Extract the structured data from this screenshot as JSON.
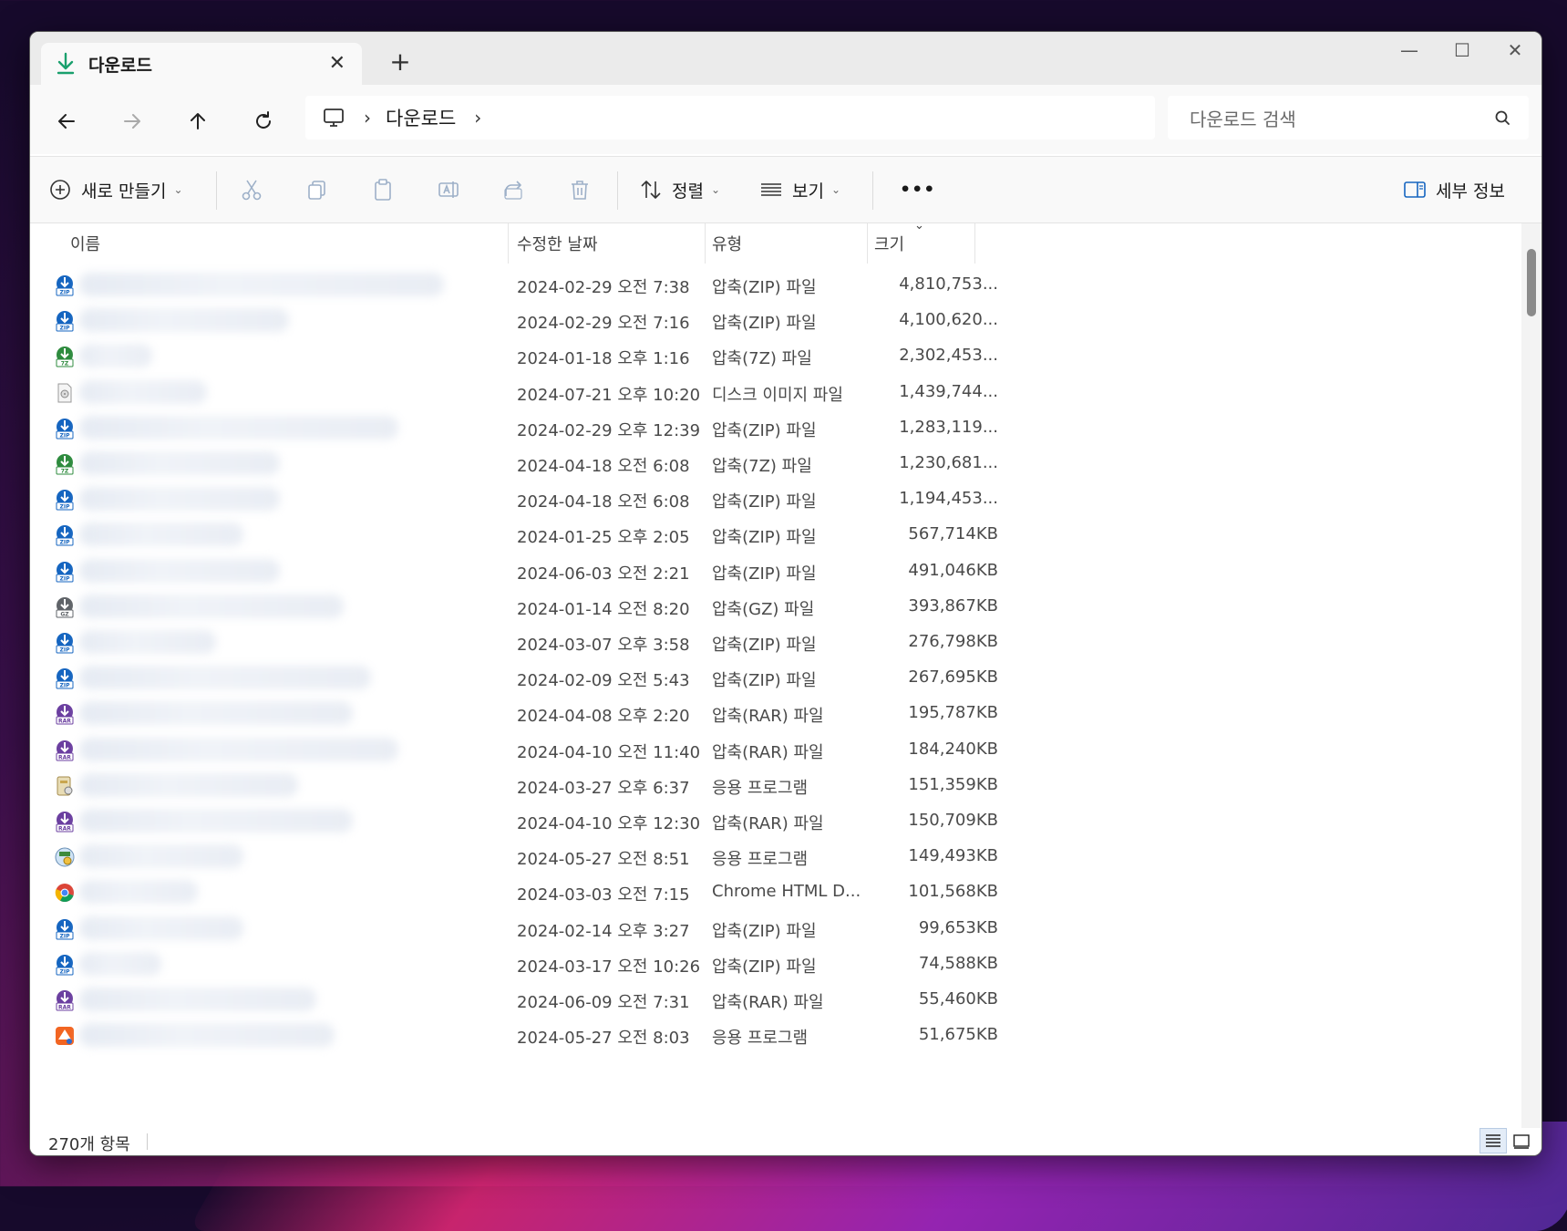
{
  "tab": {
    "title": "다운로드",
    "close": "✕",
    "new": "+"
  },
  "window_controls": {
    "minimize": "—",
    "maximize": "☐",
    "close": "✕"
  },
  "address": {
    "separator": "›",
    "crumb": "다운로드",
    "trail": "›"
  },
  "search": {
    "placeholder": "다운로드 검색"
  },
  "toolbar": {
    "new_label": "새로 만들기",
    "sort_label": "정렬",
    "view_label": "보기",
    "more_label": "•••",
    "details_label": "세부 정보",
    "chevron": "⌄"
  },
  "columns": {
    "name": "이름",
    "date": "수정한 날짜",
    "type": "유형",
    "size": "크기",
    "sort_indicator": "⌄"
  },
  "files": [
    {
      "icon": "zip-archive-icon",
      "date": "2024-02-29 오전 7:38",
      "type": "압축(ZIP) 파일",
      "size": "4,810,753..."
    },
    {
      "icon": "zip-archive-icon",
      "date": "2024-02-29 오전 7:16",
      "type": "압축(ZIP) 파일",
      "size": "4,100,620..."
    },
    {
      "icon": "7z-archive-icon",
      "date": "2024-01-18 오후 1:16",
      "type": "압축(7Z) 파일",
      "size": "2,302,453..."
    },
    {
      "icon": "disc-image-icon",
      "date": "2024-07-21 오후 10:20",
      "type": "디스크 이미지 파일",
      "size": "1,439,744..."
    },
    {
      "icon": "zip-archive-icon",
      "date": "2024-02-29 오후 12:39",
      "type": "압축(ZIP) 파일",
      "size": "1,283,119..."
    },
    {
      "icon": "7z-archive-icon",
      "date": "2024-04-18 오전 6:08",
      "type": "압축(7Z) 파일",
      "size": "1,230,681..."
    },
    {
      "icon": "zip-archive-icon",
      "date": "2024-04-18 오전 6:08",
      "type": "압축(ZIP) 파일",
      "size": "1,194,453..."
    },
    {
      "icon": "zip-archive-icon",
      "date": "2024-01-25 오후 2:05",
      "type": "압축(ZIP) 파일",
      "size": "567,714KB"
    },
    {
      "icon": "zip-archive-icon",
      "date": "2024-06-03 오전 2:21",
      "type": "압축(ZIP) 파일",
      "size": "491,046KB"
    },
    {
      "icon": "gz-archive-icon",
      "date": "2024-01-14 오전 8:20",
      "type": "압축(GZ) 파일",
      "size": "393,867KB"
    },
    {
      "icon": "zip-archive-icon",
      "date": "2024-03-07 오후 3:58",
      "type": "압축(ZIP) 파일",
      "size": "276,798KB"
    },
    {
      "icon": "zip-archive-icon",
      "date": "2024-02-09 오전 5:43",
      "type": "압축(ZIP) 파일",
      "size": "267,695KB"
    },
    {
      "icon": "rar-archive-icon",
      "date": "2024-04-08 오후 2:20",
      "type": "압축(RAR) 파일",
      "size": "195,787KB"
    },
    {
      "icon": "rar-archive-icon",
      "date": "2024-04-10 오전 11:40",
      "type": "압축(RAR) 파일",
      "size": "184,240KB"
    },
    {
      "icon": "installer-icon",
      "date": "2024-03-27 오후 6:37",
      "type": "응용 프로그램",
      "size": "151,359KB"
    },
    {
      "icon": "rar-archive-icon",
      "date": "2024-04-10 오후 12:30",
      "type": "압축(RAR) 파일",
      "size": "150,709KB"
    },
    {
      "icon": "setup-app-icon",
      "date": "2024-05-27 오전 8:51",
      "type": "응용 프로그램",
      "size": "149,493KB"
    },
    {
      "icon": "chrome-icon",
      "date": "2024-03-03 오전 7:15",
      "type": "Chrome HTML D...",
      "size": "101,568KB"
    },
    {
      "icon": "zip-archive-icon",
      "date": "2024-02-14 오후 3:27",
      "type": "압축(ZIP) 파일",
      "size": "99,653KB"
    },
    {
      "icon": "zip-archive-icon",
      "date": "2024-03-17 오전 10:26",
      "type": "압축(ZIP) 파일",
      "size": "74,588KB"
    },
    {
      "icon": "rar-archive-icon",
      "date": "2024-06-09 오전 7:31",
      "type": "압축(RAR) 파일",
      "size": "55,460KB"
    },
    {
      "icon": "app-installer-icon",
      "date": "2024-05-27 오전 8:03",
      "type": "응용 프로그램",
      "size": "51,675KB"
    }
  ],
  "status": {
    "item_count": "270개 항목"
  },
  "colors": {
    "accent": "#0078d4",
    "download_icon": "#1aa06d",
    "zip": "#1565c0",
    "sevenz": "#2e8b3e",
    "rar": "#6b3fa0",
    "gz": "#5f6368"
  }
}
